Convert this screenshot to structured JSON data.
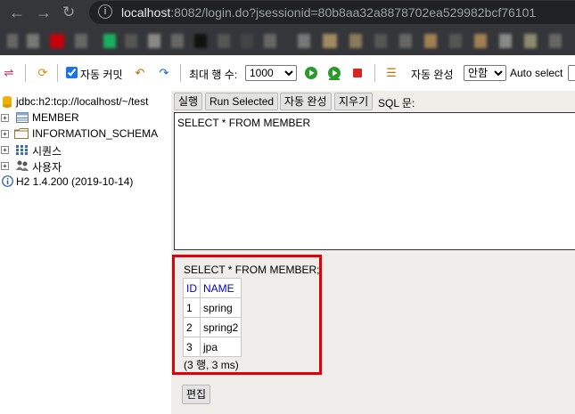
{
  "browser": {
    "url_host": "localhost",
    "url_rest": ":8082/login.do?jsessionid=80b8aa32a8878702ea529982bcf76101"
  },
  "toolbar": {
    "auto_commit_label": "자동 커밋",
    "auto_commit_checked": true,
    "max_rows_label": "최대 행 수:",
    "max_rows_value": "1000",
    "auto_complete_label": "자동 완성",
    "auto_complete_value": "안함",
    "auto_select_label": "Auto select"
  },
  "tree": {
    "connection": "jdbc:h2:tcp://localhost/~/test",
    "items": [
      {
        "label": "MEMBER",
        "icon": "table-icon"
      },
      {
        "label": "INFORMATION_SCHEMA",
        "icon": "folder-icon"
      },
      {
        "label": "시퀀스",
        "icon": "sequence-icon"
      },
      {
        "label": "사용자",
        "icon": "users-icon"
      }
    ],
    "version": "H2 1.4.200 (2019-10-14)"
  },
  "query": {
    "buttons": {
      "run": "실행",
      "run_selected": "Run Selected",
      "auto_complete": "자동 완성",
      "clear": "지우기"
    },
    "sql_label": "SQL 문:",
    "sql_text": "SELECT * FROM MEMBER"
  },
  "result": {
    "statement": "SELECT * FROM MEMBER;",
    "columns": [
      "ID",
      "NAME"
    ],
    "rows": [
      [
        "1",
        "spring"
      ],
      [
        "2",
        "spring2"
      ],
      [
        "3",
        "jpa"
      ]
    ],
    "summary": "(3 행, 3 ms)",
    "edit_button": "편집"
  },
  "colors": {
    "highlight_border": "#e0000a",
    "panel_bg": "#efeeea",
    "header_link": "#0000cc"
  }
}
